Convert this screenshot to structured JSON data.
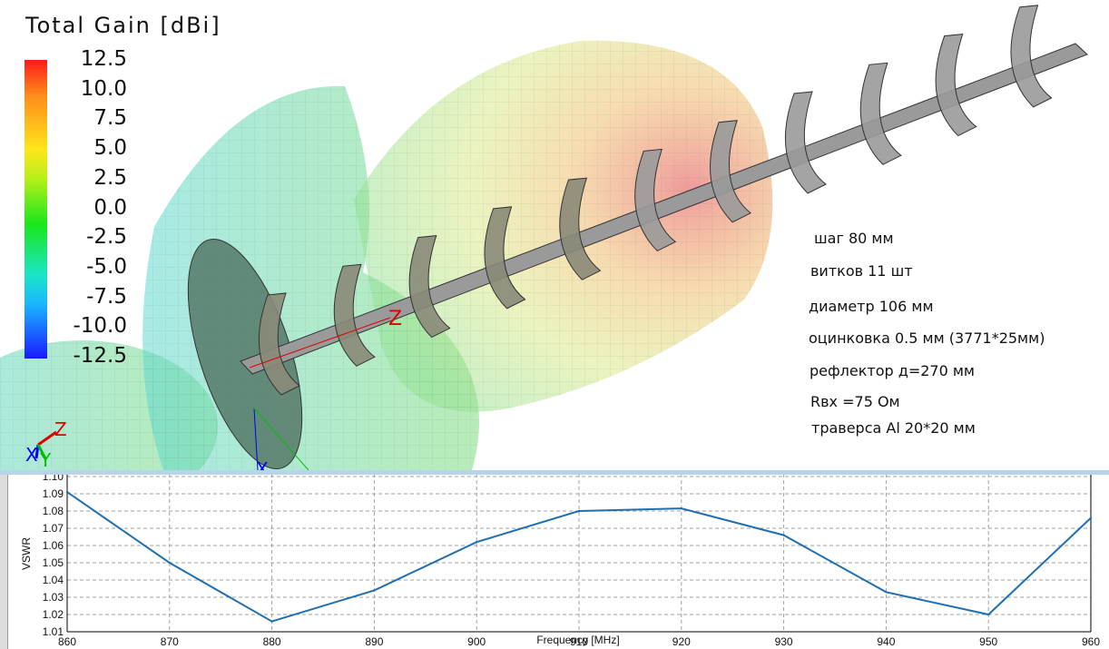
{
  "scene": {
    "legend_title": "Total Gain [dBi]",
    "colorbar_labels": [
      "12.5",
      "10.0",
      "7.5",
      "5.0",
      "2.5",
      "0.0",
      "-2.5",
      "-5.0",
      "-7.5",
      "-10.0",
      "-12.5"
    ],
    "colorbar_range": [
      -12.5,
      12.5
    ],
    "axis_labels": {
      "z": "Z",
      "x": "X",
      "y": "Y"
    },
    "notes": [
      "шаг  80 мм",
      "витков  11 шт",
      "диаметр 106 мм",
      "оцинковка 0.5 мм (3771*25мм)",
      "рефлектор д=270 мм",
      "Rвх =75 Ом",
      "траверса Al 20*20 мм"
    ],
    "colors": {
      "helix": "#8c8c8c",
      "axis_x": "#0000ff",
      "axis_y": "#00c000",
      "axis_z": "#e00000"
    }
  },
  "chart_data": {
    "type": "line",
    "title": "",
    "xlabel": "Frequency [MHz]",
    "ylabel": "VSWR",
    "xlim": [
      860,
      960
    ],
    "ylim": [
      1.01,
      1.1
    ],
    "grid": true,
    "x_ticks": [
      "860",
      "870",
      "880",
      "890",
      "900",
      "910",
      "920",
      "930",
      "940",
      "950",
      "960"
    ],
    "y_ticks": [
      "1.01",
      "1.02",
      "1.03",
      "1.04",
      "1.05",
      "1.06",
      "1.07",
      "1.08",
      "1.09",
      "1.10"
    ],
    "series": [
      {
        "color": "#1f6fb0",
        "x": [
          860,
          870,
          880,
          890,
          900,
          910,
          920,
          930,
          940,
          950,
          960
        ],
        "y": [
          1.091,
          1.05,
          1.016,
          1.034,
          1.062,
          1.08,
          1.0815,
          1.066,
          1.033,
          1.02,
          1.076
        ]
      }
    ]
  }
}
